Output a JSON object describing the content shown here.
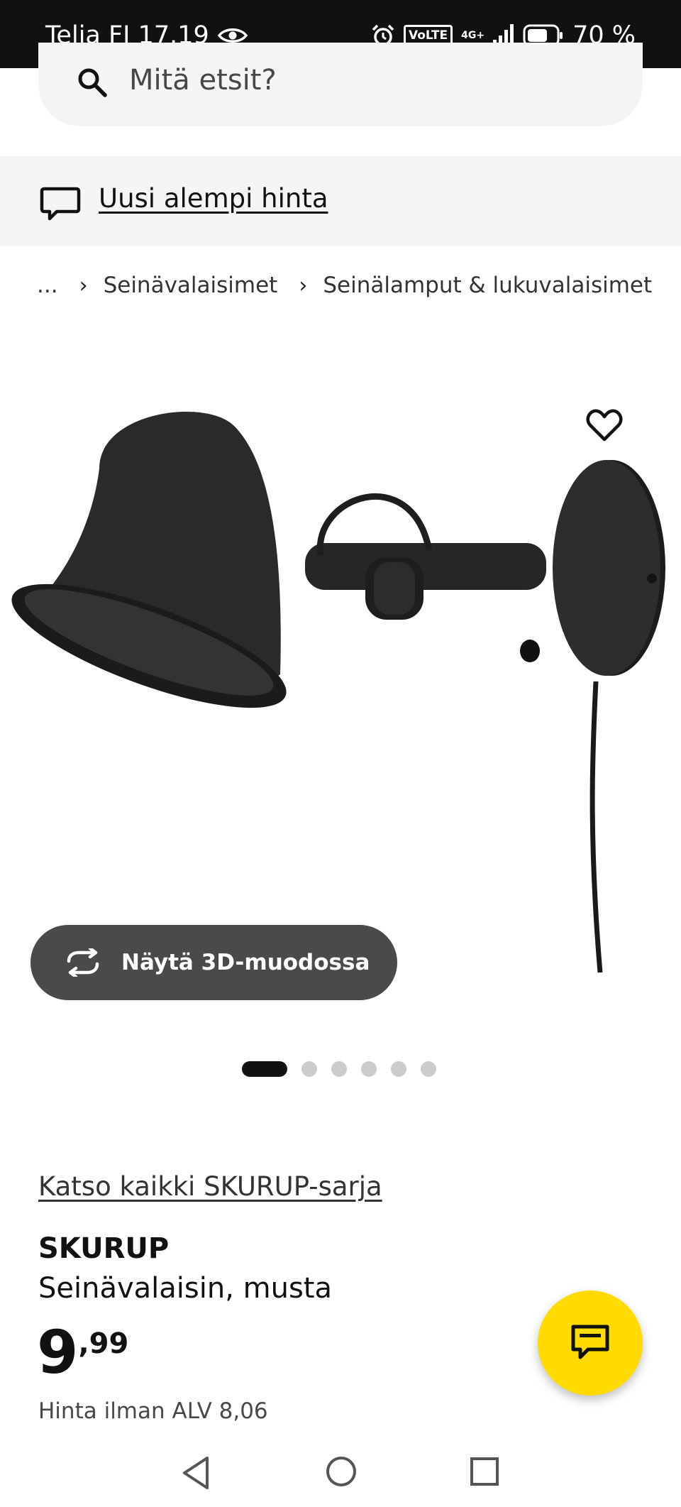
{
  "status_bar": {
    "carrier_time": "Telia FI 17.19",
    "volte": "VoLTE",
    "network": "4G+",
    "battery": "70 %"
  },
  "search": {
    "placeholder": "Mitä etsit?"
  },
  "banner": {
    "link_text": "Uusi alempi hinta",
    "icon": "speech-bubble-icon"
  },
  "breadcrumb": {
    "ellipsis": "...",
    "items": [
      "Seinävalaisimet",
      "Seinälamput & lukuvalaisimet"
    ]
  },
  "gallery": {
    "view_3d_label": "Näytä 3D-muodossa",
    "slide_count": 6,
    "active_slide": 1
  },
  "product": {
    "series_link": "Katso kaikki SKURUP-sarja",
    "name": "SKURUP",
    "description": "Seinävalaisin, musta",
    "price_integer": "9",
    "price_decimal": ",99",
    "vat_text": "Hinta ilman ALV 8,06"
  },
  "colors": {
    "status_bar": "#111111",
    "chat_button": "#ffdb00",
    "button_3d": "#4a4a4a"
  }
}
